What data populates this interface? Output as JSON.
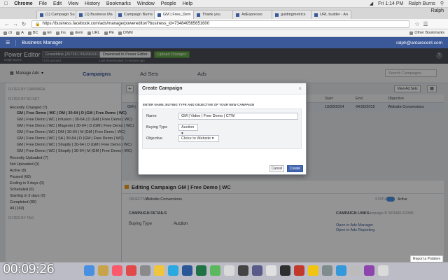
{
  "menubar": {
    "app": "Chrome",
    "items": [
      "File",
      "Edit",
      "View",
      "History",
      "Bookmarks",
      "Window",
      "People",
      "Help"
    ],
    "clock": "Fri 1:14 PM",
    "user": "Ralph Burns"
  },
  "tabs": [
    {
      "label": "(1) Campaign Su"
    },
    {
      "label": "(1) Business Ma"
    },
    {
      "label": "Campaign Burns"
    },
    {
      "label": "GM | Free_Dem"
    },
    {
      "label": "Thank you"
    },
    {
      "label": "AdEspresso"
    },
    {
      "label": "guidingmetrics"
    },
    {
      "label": "URL builder - An"
    }
  ],
  "profile": "Ralph",
  "url": "https://business.facebook.com/ads/manage/powereditor/?business_id=734840565651600",
  "bookmarks": {
    "items": [
      "cli",
      "A",
      "BC",
      "Eli",
      "Ins",
      "dwm",
      "URL",
      "PE",
      "DWM"
    ],
    "other": "Other Bookmarks"
  },
  "fbbar": {
    "title": "Business Manager",
    "email": "ralph@antarecent.com"
  },
  "power_editor": {
    "title": "Power Editor",
    "subtitle": "Ralph Burns",
    "account": "Growthlink (2073617092963313)",
    "account_sub": "7176 account",
    "download_label": "Download to Power Editor",
    "download_sub": "Last downloaded: 2 minutes ago",
    "upload_label": "Upload Changes",
    "help": "?"
  },
  "toolbar": {
    "manage_ads": "Manage Ads",
    "tabs": [
      "Campaigns",
      "Ad Sets",
      "Ads"
    ],
    "search_placeholder": "Search Campaigns",
    "view_all": "View Ad Sets",
    "plus": "+"
  },
  "sidebar": {
    "filter_campaign": "Filter by campaign",
    "filter_adset": "Filter by ad set",
    "recently_changed": "Recently Changed (7)",
    "sub_items": [
      "GM | Free Demo | WC | DM | 30-64 | D (GM | Free Demo | WC)",
      "GM | Free Demo | WC | Infusion | 30-64 | D (GM | Free Demo | WC)",
      "GM | Free Demo | WC | Magento | 30-64 | D (GM | Free Demo | WC)",
      "GM | Free Demo | WC | DM | 30-64 | M (GM | Free Demo | WC)",
      "GM | Free Demo | WC | SA | 30-64 | D (GM | Free Demo | WC)",
      "GM | Free Demo | WC | Shopify | 30-64 | D (GM | Free Demo | WC)",
      "GM | Free Demo | WC | Shopify | 30-64 | M (GM | Free Demo | WC)"
    ],
    "groups": [
      "Recently Uploaded (7)",
      "Not Uploaded (0)",
      "Active (8)",
      "Paused (68)",
      "Ending in 3 days (0)",
      "Scheduled (0)",
      "Starting in 3 days (0)",
      "Completed (80)",
      "All (160)"
    ],
    "filter_tag": "Filter by tag"
  },
  "grid": {
    "headers": [
      "Start",
      "End",
      "Objective"
    ],
    "row": {
      "name": "GM |",
      "start": "10/28/2014",
      "end": "04/30/2015",
      "objective": "Website Conversions"
    }
  },
  "edit_panel": {
    "title": "Editing Campaign  GM | Free Demo | WC",
    "objective_label": "OBJECTIVE",
    "objective_value": "Website Conversions",
    "status_label": "STATUS",
    "status_value": "Active",
    "details_header": "CAMPAIGN DETAILS",
    "links_header": "CAMPAIGN LINKS",
    "campaign_id": "Campaign ID 6026661331845",
    "buying_type_label": "Buying Type",
    "buying_type_value": "Auction",
    "link_ads_manager": "Open in Ads Manager",
    "link_ads_reporting": "Open in Ads Reporting",
    "report_problem": "Report a Problem"
  },
  "modal": {
    "title": "Create Campaign",
    "instruction": "ENTER NAME, BUYING TYPE AND OBJECTIVE OF YOUR NEW CAMPAIGN",
    "name_label": "Name",
    "name_value": "GM | Video | Free Demo | CTW",
    "buying_label": "Buying Type",
    "buying_value": "Auction ▾",
    "objective_label": "Objective",
    "objective_value": "Clicks to Website ▾",
    "cancel": "Cancel",
    "create": "Create",
    "close": "×"
  },
  "timer": "00:09:26",
  "colors": {
    "fb_blue": "#3b5998",
    "upload_green": "#69a74e",
    "create_blue": "#4267b2"
  }
}
